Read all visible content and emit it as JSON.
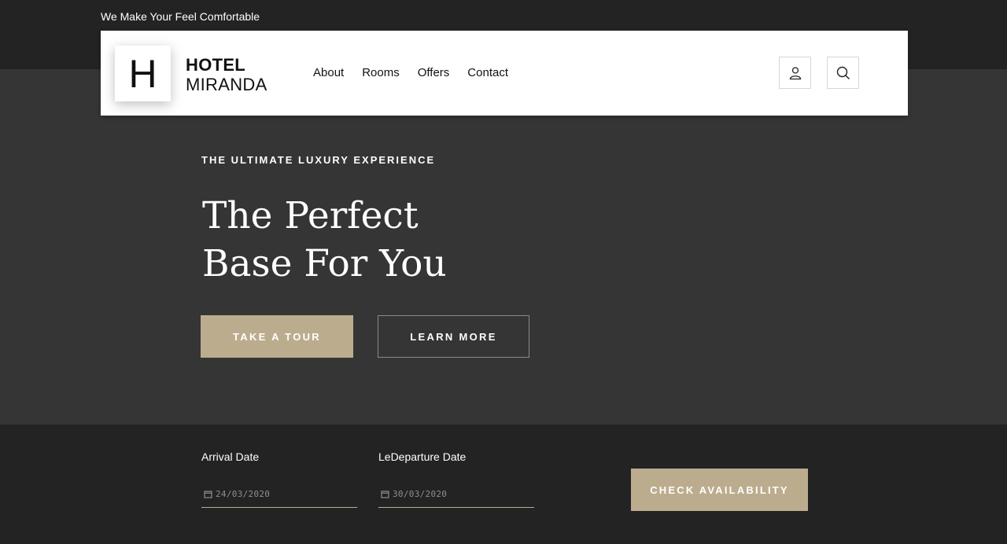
{
  "topbar": {
    "tagline": "We Make Your Feel Comfortable"
  },
  "header": {
    "logo_letter": "H",
    "logo_line1": "HOTEL",
    "logo_line2": "MIRANDA",
    "nav": [
      "About",
      "Rooms",
      "Offers",
      "Contact"
    ],
    "icons": [
      "user-icon",
      "search-icon"
    ]
  },
  "hero": {
    "eyebrow": "THE ULTIMATE LUXURY EXPERIENCE",
    "title_line1": "The Perfect",
    "title_line2": "Base For You",
    "primary_button": "TAKE A TOUR",
    "secondary_button": "LEARN MORE"
  },
  "booking": {
    "arrival_label": "Arrival Date",
    "arrival_value": "24/03/2020",
    "departure_label": "LeDeparture Date",
    "departure_value": "30/03/2020",
    "check_button": "CHECK AVAILABILITY"
  },
  "colors": {
    "accent": "#bcac8e",
    "dark_bg": "#232323",
    "hero_bg": "#353535"
  }
}
